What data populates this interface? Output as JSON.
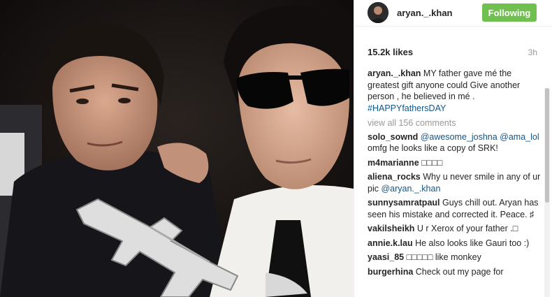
{
  "post": {
    "username": "aryan._.khan",
    "follow_label": "Following",
    "likes": "15.2k likes",
    "time_ago": "3h"
  },
  "caption": {
    "user": "aryan._.khan",
    "text": " MY father gave mé the greatest gift anyone could Give another person , he believed in mé . ",
    "hashtag": "#HAPPYfathersDAY"
  },
  "view_all": "view all 156 comments",
  "comments": [
    {
      "user": "solo_sownd",
      "mention": "@awesome_joshna @ama_lol",
      "text": " omfg he looks like a copy of SRK!"
    },
    {
      "user": "m4marianne",
      "text": " □□□□"
    },
    {
      "user": "aliena_rocks",
      "text": " Why u never smile in any of ur pic ",
      "mention": "@aryan._.khan"
    },
    {
      "user": "sunnysamratpaul",
      "text": " Guys chill out. Aryan has seen his mistake and corrected it. Peace. ♯"
    },
    {
      "user": "vakilsheikh",
      "text": " U r Xerox of your father .□"
    },
    {
      "user": "annie.k.lau",
      "text": " He also looks like Gauri too :)"
    },
    {
      "user": "yaasi_85",
      "text": " □□□□□ like monkey"
    },
    {
      "user": "burgerhina",
      "text": " Check out my page for"
    }
  ],
  "colors": {
    "follow_button": "#70c050",
    "link": "#125688",
    "muted": "#999999"
  }
}
